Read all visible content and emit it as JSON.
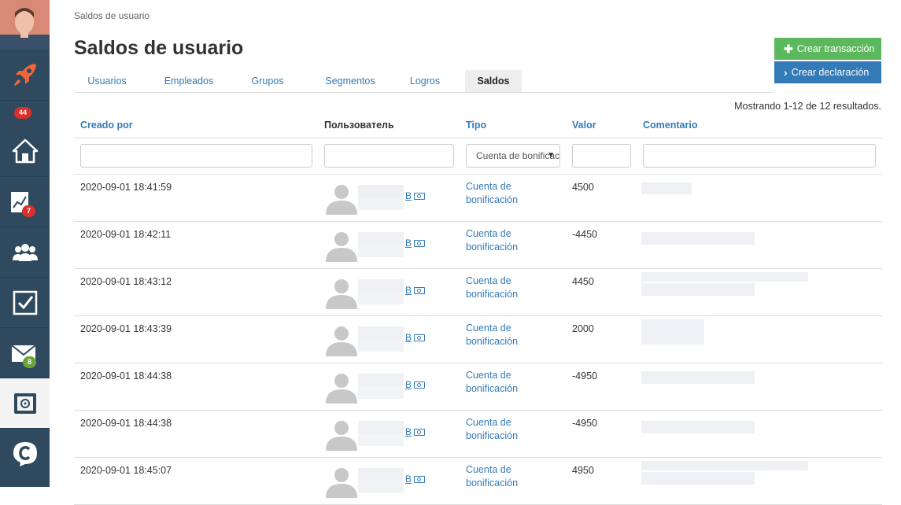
{
  "breadcrumb": "Saldos de usuario",
  "page_title": "Saldos de usuario",
  "buttons": {
    "create_transaction": "Crear transacción",
    "create_declaration": "Crear declaración"
  },
  "tabs": [
    {
      "label": "Usuarios",
      "active": false
    },
    {
      "label": "Empleados",
      "active": false
    },
    {
      "label": "Grupos",
      "active": false
    },
    {
      "label": "Segmentos",
      "active": false
    },
    {
      "label": "Logros",
      "active": false
    },
    {
      "label": "Saldos",
      "active": true
    }
  ],
  "summary": "Mostrando 1-12 de 12 resultados.",
  "columns": {
    "created_by": "Creado por",
    "user": "Пользователь",
    "type": "Tipo",
    "value": "Valor",
    "comment": "Comentario"
  },
  "filters": {
    "type_selected": "Cuenta de bonificación"
  },
  "sidebar": {
    "badges": {
      "top": "44",
      "analytics": "7",
      "mail": "8"
    },
    "icons": [
      "rocket-icon",
      "home-icon",
      "analytics-icon",
      "users-icon",
      "checkbox-icon",
      "mail-icon",
      "safe-icon",
      "chat-icon"
    ]
  },
  "rows": [
    {
      "date": "2020-09-01 18:41:59",
      "type_line1": "Cuenta de",
      "type_line2": "bonificación",
      "value": "4500",
      "user_initial": "B"
    },
    {
      "date": "2020-09-01 18:42:11",
      "type_line1": "Cuenta de",
      "type_line2": "bonificación",
      "value": "-4450",
      "user_initial": "B"
    },
    {
      "date": "2020-09-01 18:43:12",
      "type_line1": "Cuenta de",
      "type_line2": "bonificación",
      "value": "4450",
      "user_initial": "B"
    },
    {
      "date": "2020-09-01 18:43:39",
      "type_line1": "Cuenta de",
      "type_line2": "bonificación",
      "value": "2000",
      "user_initial": "B"
    },
    {
      "date": "2020-09-01 18:44:38",
      "type_line1": "Cuenta de",
      "type_line2": "bonificación",
      "value": "-4950",
      "user_initial": "B"
    },
    {
      "date": "2020-09-01 18:44:38",
      "type_line1": "Cuenta de",
      "type_line2": "bonificación",
      "value": "-4950",
      "user_initial": "B"
    },
    {
      "date": "2020-09-01 18:45:07",
      "type_line1": "Cuenta de",
      "type_line2": "bonificación",
      "value": "4950",
      "user_initial": "B"
    }
  ]
}
